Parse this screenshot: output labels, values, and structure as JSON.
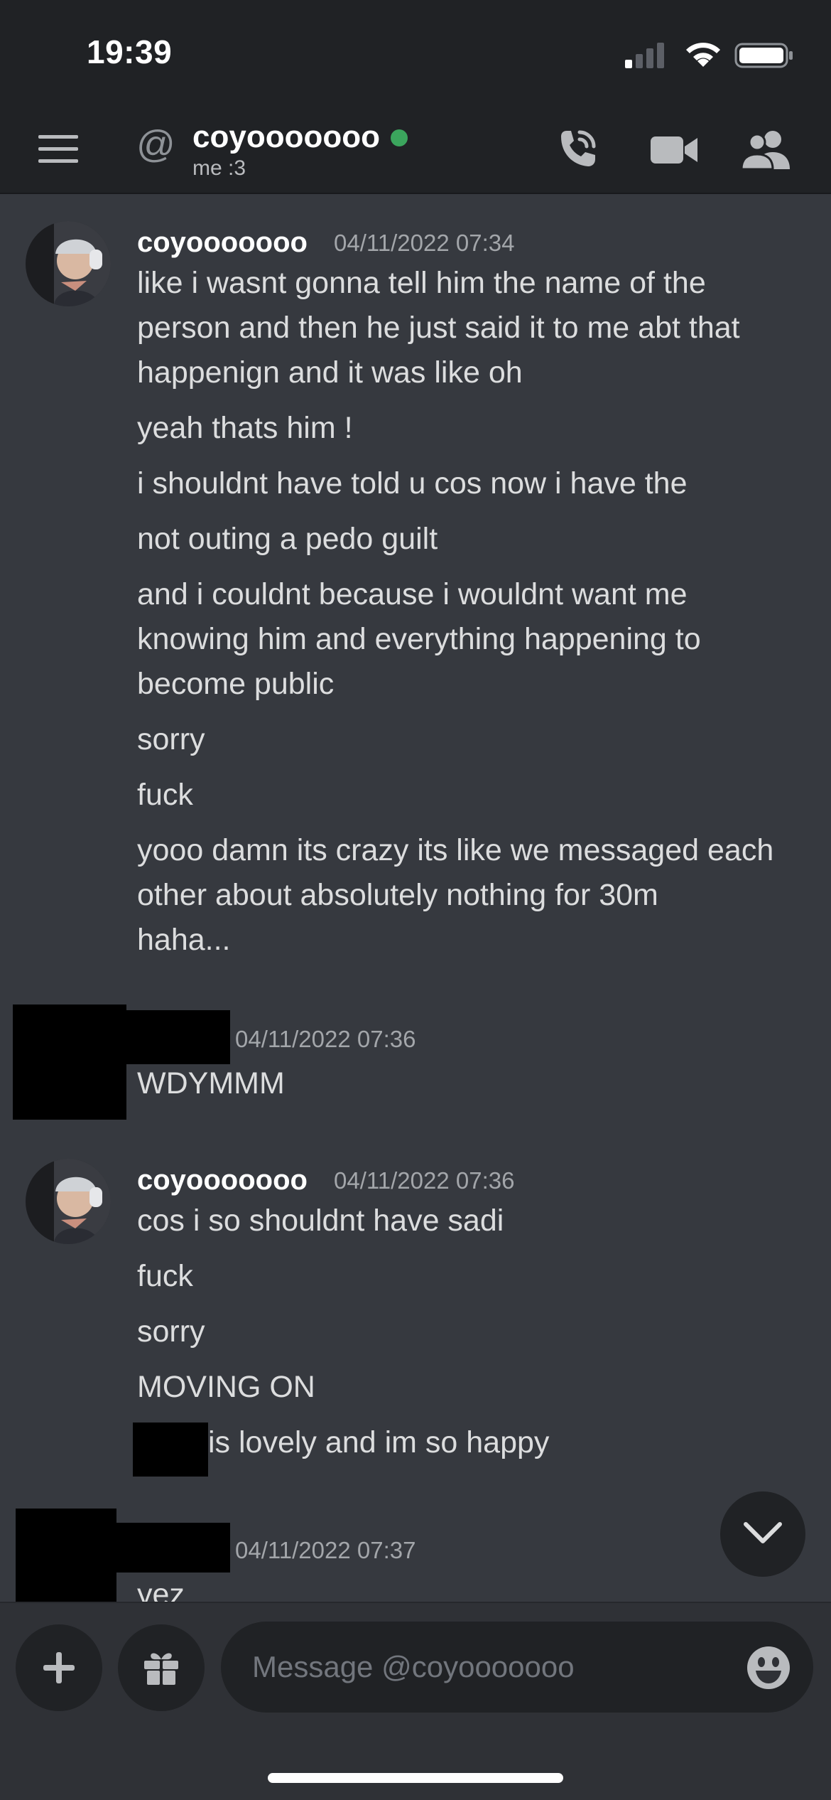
{
  "status_bar": {
    "time": "19:39"
  },
  "header": {
    "at_symbol": "@",
    "channel_name": "coyooooooo",
    "status_text": "me :3"
  },
  "messages": [
    {
      "author": "coyooooooo",
      "timestamp": "04/11/2022 07:34",
      "lines": [
        "like i wasnt gonna tell him the name of the",
        "person and then he just said it to me abt that",
        "happenign and it was like oh",
        "yeah thats him !",
        "i shouldnt have told u cos now i have the",
        "not outing a pedo guilt",
        "and i couldnt because i wouldnt want me",
        "knowing him and everything happening to",
        "become public",
        "sorry",
        "fuck",
        "yooo damn its crazy its like we messaged each",
        "other about absolutely nothing for 30m",
        "haha..."
      ]
    },
    {
      "author": "",
      "timestamp": "04/11/2022 07:36",
      "lines": [
        "WDYMMM"
      ]
    },
    {
      "author": "coyooooooo",
      "timestamp": "04/11/2022 07:36",
      "lines": [
        "cos i so shouldnt have sadi",
        "fuck",
        "sorry",
        "MOVING ON",
        "is lovely and im so happy"
      ]
    },
    {
      "author": "",
      "timestamp": "04/11/2022 07:37",
      "lines": [
        "yez"
      ]
    }
  ],
  "composer": {
    "placeholder": "Message @coyooooooo"
  },
  "colors": {
    "background": "#36393f",
    "header_bg": "#202225",
    "online": "#3ba55d",
    "redaction": "#000000"
  },
  "icons": {
    "menu": "hamburger-icon",
    "call": "call-icon",
    "video": "video-icon",
    "members": "members-icon",
    "scroll_down": "chevron-down-icon",
    "add": "plus-icon",
    "gift": "gift-icon",
    "emoji": "emoji-icon"
  }
}
